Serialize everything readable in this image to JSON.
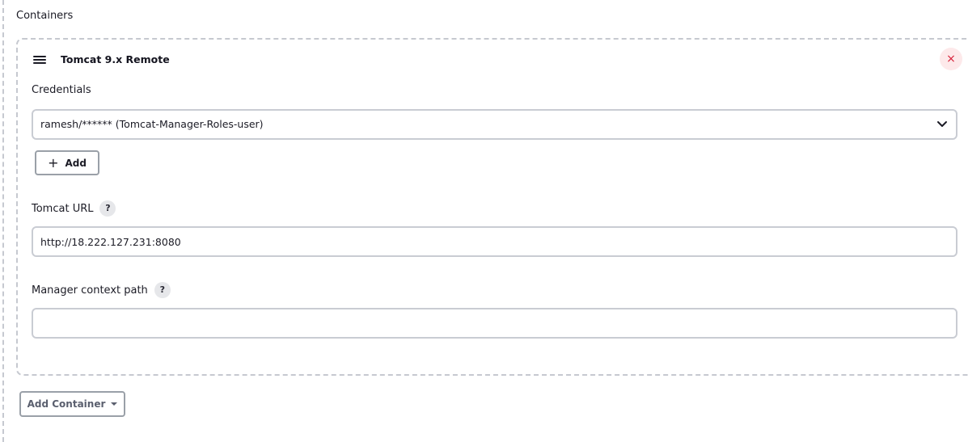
{
  "section": {
    "label": "Containers"
  },
  "container": {
    "title": "Tomcat 9.x Remote",
    "close_icon": "×",
    "credentials": {
      "label": "Credentials",
      "selected": "ramesh/****** (Tomcat-Manager-Roles-user)",
      "add_label": "Add",
      "add_icon": "+"
    },
    "tomcat_url": {
      "label": "Tomcat URL",
      "help": "?",
      "value": "http://18.222.127.231:8080"
    },
    "manager_context_path": {
      "label": "Manager context path",
      "help": "?",
      "value": ""
    }
  },
  "footer": {
    "add_container_label": "Add Container"
  },
  "icons": {
    "drag": "drag-handle-icon",
    "close": "close-icon",
    "chevron": "chevron-down-icon",
    "help": "help-icon",
    "plus": "plus-icon",
    "caret": "caret-down-icon"
  },
  "colors": {
    "close_bg": "#fde9ea",
    "close_fg": "#d8243c",
    "border": "#c9ccd3",
    "dashed": "#c6c9d0"
  }
}
